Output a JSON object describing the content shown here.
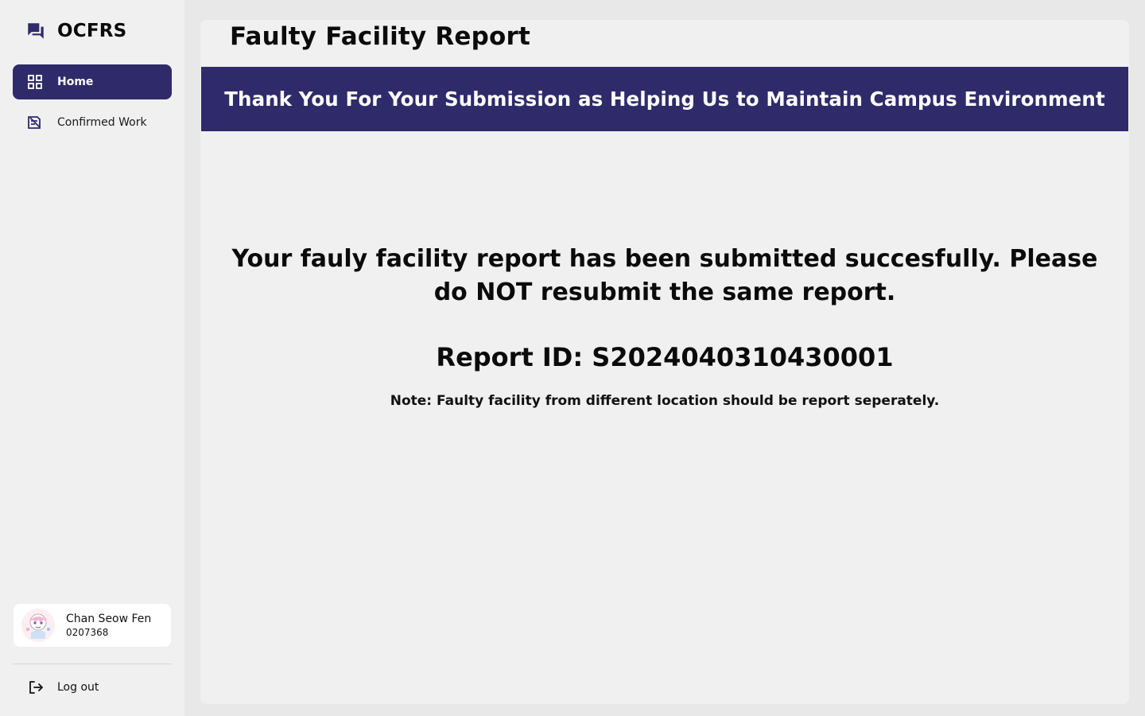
{
  "app": {
    "name": "OCFRS"
  },
  "sidebar": {
    "items": [
      {
        "label": "Home",
        "icon": "grid-icon",
        "active": true
      },
      {
        "label": "Confirmed Work",
        "icon": "confirmed-work-icon",
        "active": false
      }
    ],
    "user": {
      "name": "Chan Seow Fen",
      "id": "0207368"
    },
    "logout_label": "Log out"
  },
  "main": {
    "title": "Faulty Facility Report",
    "banner": "Thank You For Your Submission as Helping Us to Maintain Campus Environment",
    "success_message": "Your fauly facility report has been submitted succesfully. Please do NOT resubmit the same report.",
    "report_id_label": "Report ID: S2024040310430001",
    "note": "Note: Faulty facility from different location should be report seperately."
  },
  "colors": {
    "accent": "#2f2b6b",
    "panel": "#f0f0f0",
    "background": "#e8e8e8"
  }
}
